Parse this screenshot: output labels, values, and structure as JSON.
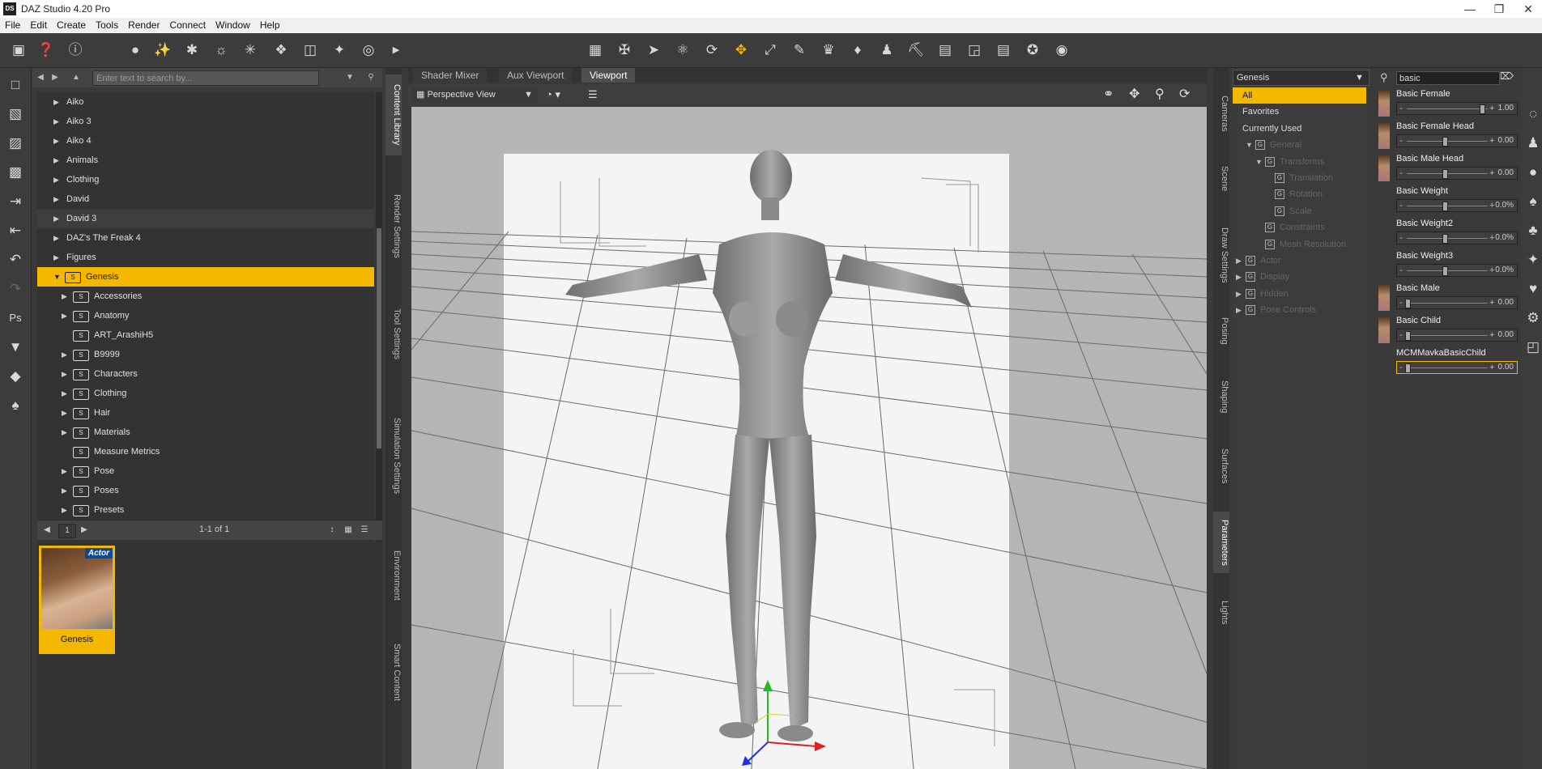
{
  "app": {
    "title": "DAZ Studio 4.20 Pro",
    "logo": "DS"
  },
  "menu": [
    "File",
    "Edit",
    "Create",
    "Tools",
    "Render",
    "Connect",
    "Window",
    "Help"
  ],
  "content_library": {
    "search_placeholder": "Enter text to search by...",
    "tree": [
      {
        "label": "Aiko",
        "level": 0,
        "folder": false,
        "expand": true
      },
      {
        "label": "Aiko 3",
        "level": 0,
        "folder": false,
        "expand": true
      },
      {
        "label": "Aiko 4",
        "level": 0,
        "folder": false,
        "expand": true
      },
      {
        "label": "Animals",
        "level": 0,
        "folder": false,
        "expand": true
      },
      {
        "label": "Clothing",
        "level": 0,
        "folder": false,
        "expand": true
      },
      {
        "label": "David",
        "level": 0,
        "folder": false,
        "expand": true
      },
      {
        "label": "David 3",
        "level": 0,
        "folder": false,
        "expand": true,
        "highlight": true
      },
      {
        "label": "DAZ's The Freak 4",
        "level": 0,
        "folder": false,
        "expand": true
      },
      {
        "label": "Figures",
        "level": 0,
        "folder": false,
        "expand": true
      },
      {
        "label": "Genesis",
        "level": 0,
        "folder": true,
        "expand": true,
        "open": true,
        "selected": true
      },
      {
        "label": "Accessories",
        "level": 1,
        "folder": true,
        "expand": true
      },
      {
        "label": "Anatomy",
        "level": 1,
        "folder": true,
        "expand": true
      },
      {
        "label": "ART_ArashiH5",
        "level": 1,
        "folder": true,
        "expand": false
      },
      {
        "label": "B9999",
        "level": 1,
        "folder": true,
        "expand": true
      },
      {
        "label": "Characters",
        "level": 1,
        "folder": true,
        "expand": true
      },
      {
        "label": "Clothing",
        "level": 1,
        "folder": true,
        "expand": true
      },
      {
        "label": "Hair",
        "level": 1,
        "folder": true,
        "expand": true
      },
      {
        "label": "Materials",
        "level": 1,
        "folder": true,
        "expand": true
      },
      {
        "label": "Measure Metrics",
        "level": 1,
        "folder": true,
        "expand": false
      },
      {
        "label": "Pose",
        "level": 1,
        "folder": true,
        "expand": true
      },
      {
        "label": "Poses",
        "level": 1,
        "folder": true,
        "expand": true
      },
      {
        "label": "Presets",
        "level": 1,
        "folder": true,
        "expand": true
      }
    ],
    "page_number": "1",
    "page_count": "1-1 of 1",
    "asset": {
      "name": "Genesis",
      "badge": "Actor"
    }
  },
  "left_vtabs": [
    "Content Library",
    "Render Settings",
    "Tool Settings",
    "Simulation Settings",
    "Environment",
    "Smart Content"
  ],
  "viewport": {
    "tabs": [
      "Shader Mixer",
      "Aux Viewport",
      "Viewport"
    ],
    "active_tab": "Viewport",
    "camera": "Perspective View"
  },
  "right_vtabs": [
    "Cameras",
    "Scene",
    "Draw Settings",
    "Posing",
    "Shaping",
    "Surfaces",
    "Parameters",
    "Lights"
  ],
  "parameters": {
    "node": "Genesis",
    "search_value": "basic",
    "groups": [
      {
        "label": "All",
        "indent": 0,
        "selected": true
      },
      {
        "label": "Favorites",
        "indent": 0
      },
      {
        "label": "Currently Used",
        "indent": 0
      },
      {
        "label": "General",
        "indent": 1,
        "dim": true,
        "icon": true,
        "expand": "open"
      },
      {
        "label": "Transforms",
        "indent": 2,
        "dim": true,
        "icon": true,
        "expand": "open"
      },
      {
        "label": "Translation",
        "indent": 3,
        "dim": true,
        "icon": true
      },
      {
        "label": "Rotation",
        "indent": 3,
        "dim": true,
        "icon": true
      },
      {
        "label": "Scale",
        "indent": 3,
        "dim": true,
        "icon": true
      },
      {
        "label": "Constraints",
        "indent": 2,
        "dim": true,
        "icon": true
      },
      {
        "label": "Mesh Resolution",
        "indent": 2,
        "dim": true,
        "icon": true
      },
      {
        "label": "Actor",
        "indent": 0,
        "dim": true,
        "icon": true,
        "expand": "closed"
      },
      {
        "label": "Display",
        "indent": 0,
        "dim": true,
        "icon": true,
        "expand": "closed"
      },
      {
        "label": "Hidden",
        "indent": 0,
        "dim": true,
        "icon": true,
        "expand": "closed"
      },
      {
        "label": "Pose Controls",
        "indent": 0,
        "dim": true,
        "icon": true,
        "expand": "closed"
      }
    ],
    "sliders": [
      {
        "name": "Basic Female",
        "value": "1.00",
        "fraction": 1.0,
        "thumb": true
      },
      {
        "name": "Basic Female Head",
        "value": "0.00",
        "fraction": 0.5,
        "thumb": true
      },
      {
        "name": "Basic Male Head",
        "value": "0.00",
        "fraction": 0.5,
        "thumb": true
      },
      {
        "name": "Basic Weight",
        "value": "0.0%",
        "fraction": 0.5,
        "thumb": false
      },
      {
        "name": "Basic Weight2",
        "value": "0.0%",
        "fraction": 0.5,
        "thumb": false
      },
      {
        "name": "Basic Weight3",
        "value": "0.0%",
        "fraction": 0.5,
        "thumb": false
      },
      {
        "name": "Basic Male",
        "value": "0.00",
        "fraction": 0.0,
        "thumb": true
      },
      {
        "name": "Basic Child",
        "value": "0.00",
        "fraction": 0.0,
        "thumb": true
      },
      {
        "name": "MCMMavkaBasicChild",
        "value": "0.00",
        "fraction": 0.0,
        "thumb": false,
        "selected": true
      }
    ]
  }
}
